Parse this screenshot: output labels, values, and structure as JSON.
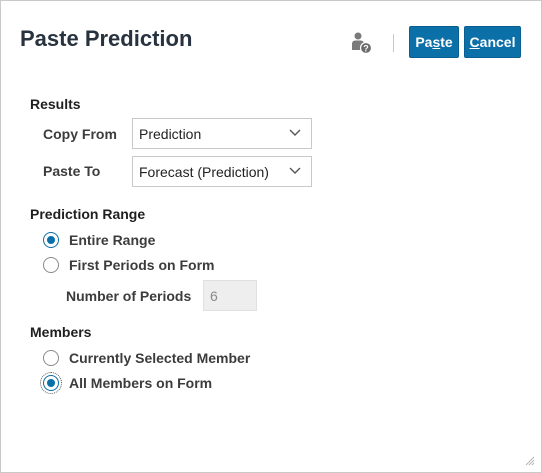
{
  "dialog": {
    "title": "Paste Prediction",
    "help_icon": "user-help-icon",
    "paste_button": {
      "pre": "Pa",
      "underlined": "s",
      "post": "te"
    },
    "cancel_button": {
      "pre": "",
      "underlined": "C",
      "post": "ancel"
    }
  },
  "results": {
    "title": "Results",
    "copy_from": {
      "label": "Copy From",
      "value": "Prediction"
    },
    "paste_to": {
      "label": "Paste To",
      "value": "Forecast (Prediction)"
    }
  },
  "prediction_range": {
    "title": "Prediction Range",
    "options": [
      {
        "label": "Entire Range",
        "checked": true
      },
      {
        "label": "First Periods on Form",
        "checked": false
      }
    ],
    "number_of_periods": {
      "label": "Number of Periods",
      "value": "6"
    }
  },
  "members": {
    "title": "Members",
    "options": [
      {
        "label": "Currently Selected Member",
        "checked": false
      },
      {
        "label": "All Members on Form",
        "checked": true
      }
    ]
  },
  "colors": {
    "accent": "#0b6fa8",
    "title": "#28333f"
  }
}
